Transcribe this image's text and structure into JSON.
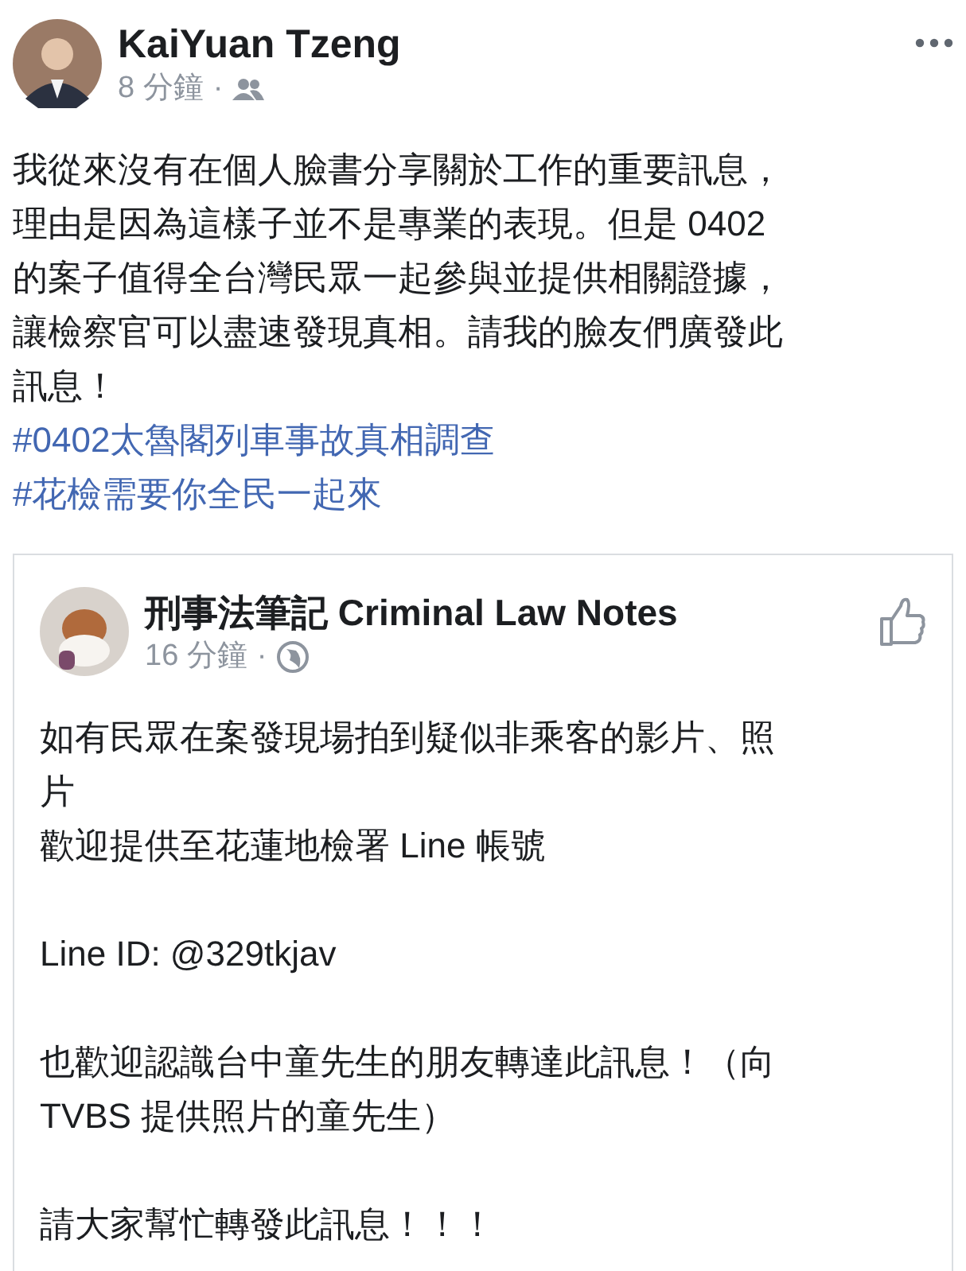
{
  "post": {
    "author": "KaiYuan Tzeng",
    "time": "8 分鐘",
    "separator": "·",
    "public": false,
    "lines": [
      "我從來沒有在個人臉書分享關於工作的重要訊息，",
      "理由是因為這樣子並不是專業的表現。但是 0402",
      "的案子值得全台灣民眾一起參與並提供相關證據，",
      "讓檢察官可以盡速發現真相。請我的臉友們廣發此",
      "訊息！"
    ],
    "hashtags": [
      "#0402太魯閣列車事故真相調查",
      "#花檢需要你全民一起來"
    ]
  },
  "shared_post": {
    "author": "刑事法筆記 Criminal Law Notes",
    "time": "16 分鐘",
    "separator": "·",
    "public": true,
    "paragraphs": [
      [
        "如有民眾在案發現場拍到疑似非乘客的影片、照",
        "片",
        "歡迎提供至花蓮地檢署 Line 帳號"
      ],
      [
        "Line ID: @329tkjav"
      ],
      [
        "也歡迎認識台中童先生的朋友轉達此訊息！（向",
        "TVBS 提供照片的童先生）"
      ],
      [
        "請大家幫忙轉發此訊息！！！"
      ]
    ]
  }
}
